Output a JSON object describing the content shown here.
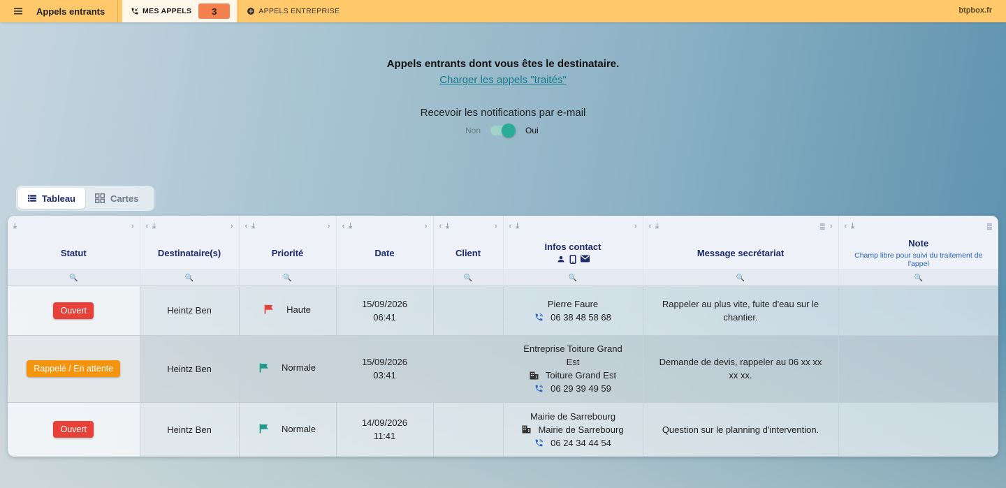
{
  "topbar": {
    "app_title": "Appels entrants",
    "tab_mine": "MES APPELS",
    "tab_mine_count": "3",
    "tab_company": "APPELS ENTREPRISE",
    "brand": "btpbox.fr"
  },
  "intro": {
    "title": "Appels entrants dont vous êtes le destinataire.",
    "load_link": "Charger les appels \"traités\"",
    "notif_label": "Recevoir les notifications par e-mail",
    "toggle_off": "Non",
    "toggle_on": "Oui",
    "toggle_value": true
  },
  "views": {
    "table": "Tableau",
    "cards": "Cartes",
    "active": "Tableau"
  },
  "table": {
    "columns": {
      "statut": "Statut",
      "destinataires": "Destinataire(s)",
      "priorite": "Priorité",
      "date": "Date",
      "client": "Client",
      "infos": "Infos contact",
      "message": "Message secrétariat",
      "note": "Note",
      "note_sub": "Champ libre pour suivi du traitement de l'appel"
    },
    "rows": [
      {
        "status": "Ouvert",
        "status_color": "#e8413a",
        "recipient": "Heintz Ben",
        "priority": "Haute",
        "priority_color": "#e8413a",
        "date": "15/09/2026",
        "time": "06:41",
        "client": "",
        "contact_name": "Pierre Faure",
        "contact_phone": "06 38 48 58 68",
        "message": "Rappeler au plus vite, fuite d'eau sur le chantier.",
        "note": ""
      },
      {
        "status": "Rappelé / En attente",
        "status_color": "#f5940f",
        "recipient": "Heintz Ben",
        "priority": "Normale",
        "priority_color": "#1f9a8a",
        "date": "15/09/2026",
        "time": "03:41",
        "client": "",
        "contact_name": "Entreprise Toiture Grand Est",
        "contact_company": "Toiture Grand Est",
        "contact_phone": "06 29 39 49 59",
        "message": "Demande de devis, rappeler au 06 xx xx xx xx.",
        "note": ""
      },
      {
        "status": "Ouvert",
        "status_color": "#e8413a",
        "recipient": "Heintz Ben",
        "priority": "Normale",
        "priority_color": "#1f9a8a",
        "date": "14/09/2026",
        "time": "11:41",
        "client": "",
        "contact_name": "Mairie de Sarrebourg",
        "contact_company": "Mairie de Sarrebourg",
        "contact_phone": "06 24 34 44 54",
        "message": "Question sur le planning d'intervention.",
        "note": ""
      }
    ]
  }
}
